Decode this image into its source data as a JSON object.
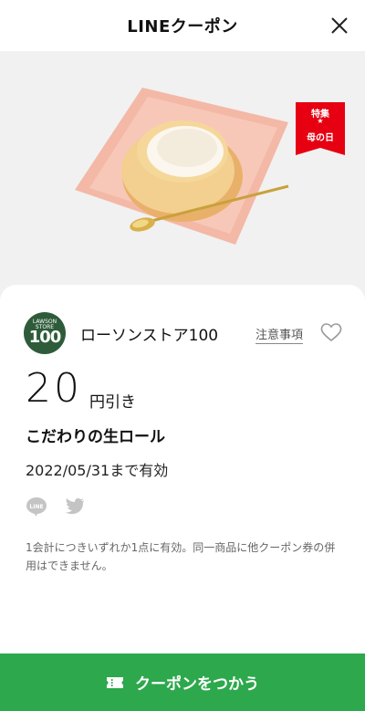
{
  "header": {
    "title": "LINEクーポン",
    "close_icon": "close-icon"
  },
  "hero": {
    "ribbon_top": "特集",
    "ribbon_star": "★",
    "ribbon_bottom": "母の日",
    "ribbon_color": "#e60012",
    "image": "roll-cake-photo"
  },
  "store": {
    "logo_small": "LAWSON STORE",
    "logo_number": "100",
    "name": "ローソンストア100",
    "notes_label": "注意事項",
    "favorite_icon": "heart-icon"
  },
  "coupon": {
    "discount_value": "20",
    "discount_unit": "円引き",
    "product": "こだわりの生ロール",
    "validity": "2022/05/31まで有効",
    "terms": "1会計につきいずれか1点に有効。同一商品に他クーポン券の併用はできません。"
  },
  "share": {
    "line_icon": "line-icon",
    "twitter_icon": "twitter-icon"
  },
  "action": {
    "use_label": "クーポンをつかう",
    "color": "#2ea84d",
    "icon": "ticket-icon"
  }
}
